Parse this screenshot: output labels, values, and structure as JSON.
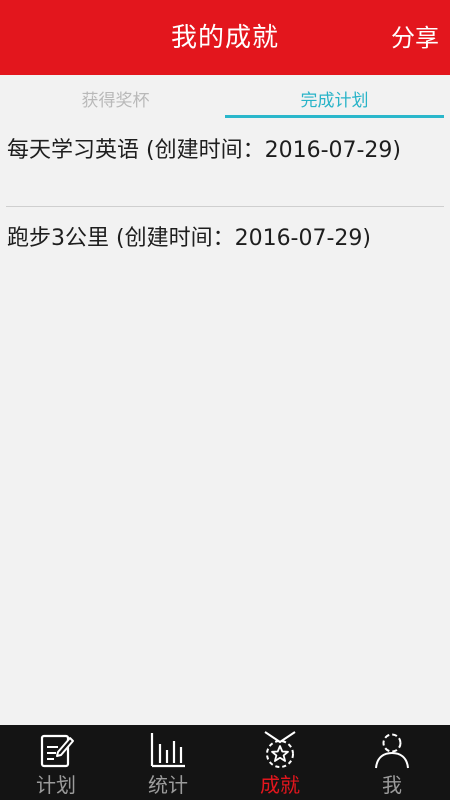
{
  "header": {
    "title": "我的成就",
    "share_label": "分享"
  },
  "tabs": [
    {
      "label": "获得奖杯",
      "active": false
    },
    {
      "label": "完成计划",
      "active": true
    }
  ],
  "plans": [
    {
      "text": "每天学习英语 (创建时间：2016-07-29)"
    },
    {
      "text": "跑步3公里 (创建时间：2016-07-29)"
    }
  ],
  "bottom_nav": [
    {
      "label": "计划",
      "icon": "edit-note-icon",
      "active": false
    },
    {
      "label": "统计",
      "icon": "bar-chart-icon",
      "active": false
    },
    {
      "label": "成就",
      "icon": "medal-star-icon",
      "active": true
    },
    {
      "label": "我",
      "icon": "person-icon",
      "active": false
    }
  ],
  "colors": {
    "header_red": "#e3161d",
    "tab_active": "#29b4c8",
    "nav_background": "#141414",
    "nav_inactive": "#9b9b9b"
  }
}
